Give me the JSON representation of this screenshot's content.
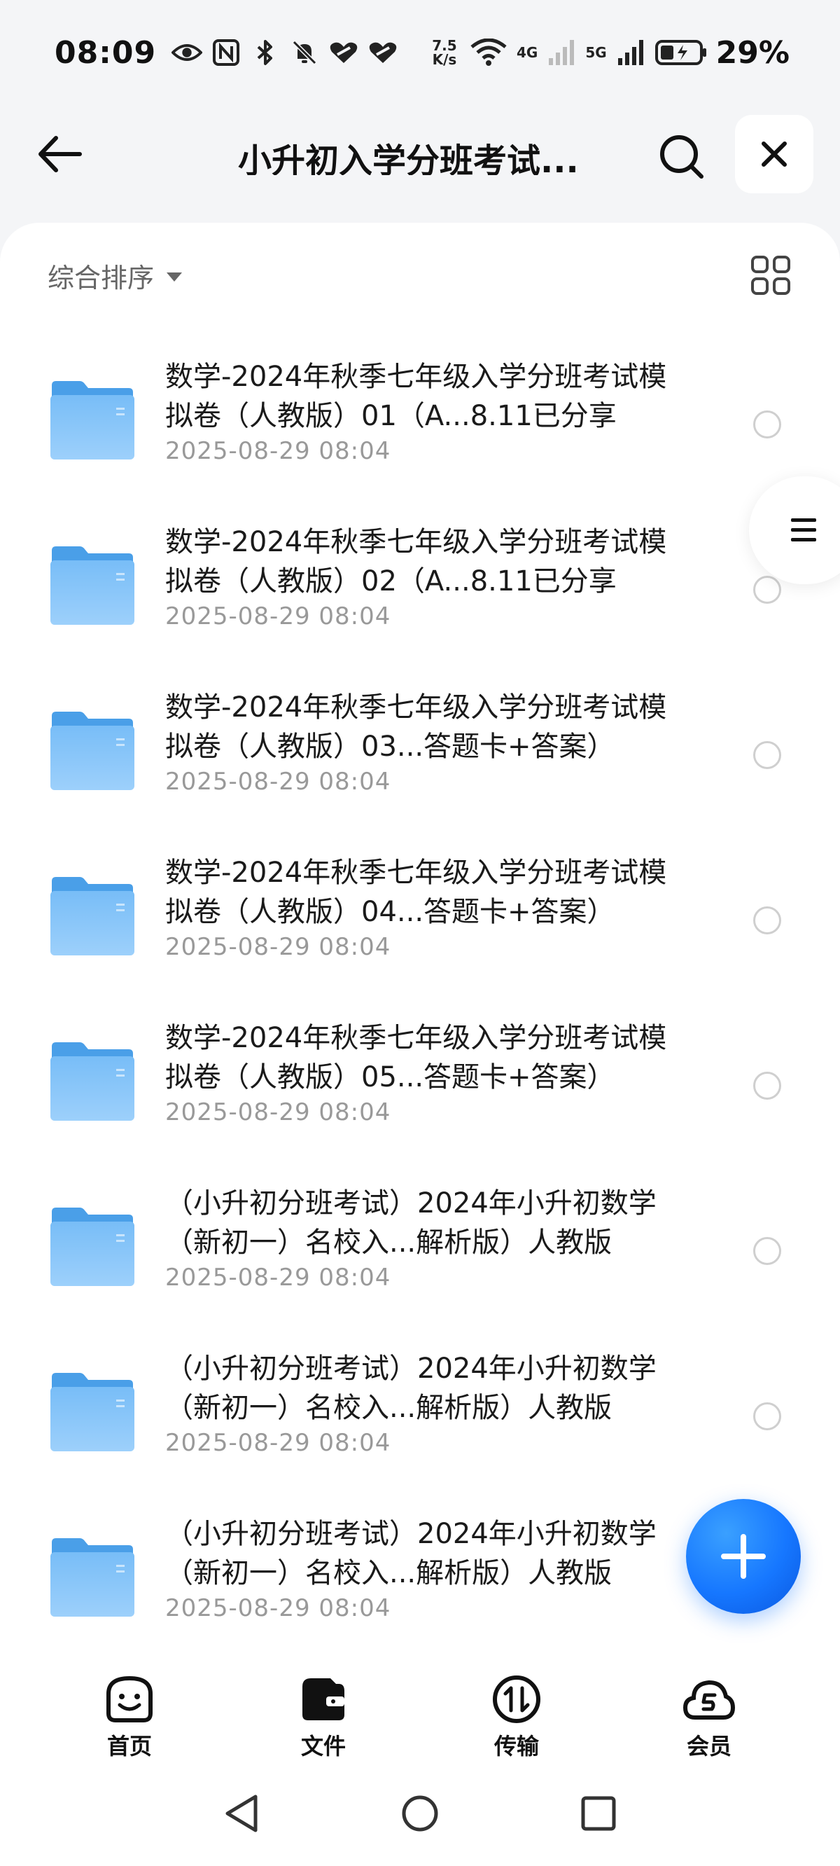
{
  "status_bar": {
    "time": "08:09",
    "net_speed_value": "7.5",
    "net_speed_unit": "K/s",
    "sig_4g": "4G",
    "sig_5g": "5G",
    "battery": "29%"
  },
  "header": {
    "title": "小升初入学分班考试..."
  },
  "toolbar": {
    "sort_label": "综合排序"
  },
  "files": [
    {
      "name": "数学-2024年秋季七年级入学分班考试模拟卷（人教版）01（A...8.11已分享",
      "date": "2025-08-29 08:04"
    },
    {
      "name": "数学-2024年秋季七年级入学分班考试模拟卷（人教版）02（A...8.11已分享",
      "date": "2025-08-29 08:04"
    },
    {
      "name": "数学-2024年秋季七年级入学分班考试模拟卷（人教版）03...答题卡+答案）",
      "date": "2025-08-29 08:04"
    },
    {
      "name": "数学-2024年秋季七年级入学分班考试模拟卷（人教版）04...答题卡+答案）",
      "date": "2025-08-29 08:04"
    },
    {
      "name": "数学-2024年秋季七年级入学分班考试模拟卷（人教版）05...答题卡+答案）",
      "date": "2025-08-29 08:04"
    },
    {
      "name": "（小升初分班考试）2024年小升初数学（新初一）名校入...解析版）人教版",
      "date": "2025-08-29 08:04"
    },
    {
      "name": "（小升初分班考试）2024年小升初数学（新初一）名校入...解析版）人教版",
      "date": "2025-08-29 08:04"
    },
    {
      "name": "（小升初分班考试）2024年小升初数学（新初一）名校入...解析版）人教版",
      "date": "2025-08-29 08:04"
    }
  ],
  "bottom_nav": [
    {
      "label": "首页",
      "icon": "smiley-home-icon"
    },
    {
      "label": "文件",
      "icon": "wallet-files-icon"
    },
    {
      "label": "传输",
      "icon": "transfer-icon"
    },
    {
      "label": "会员",
      "icon": "cloud-vip-icon"
    }
  ],
  "colors": {
    "accent": "#1677ff",
    "folder": "#5aacf2",
    "background": "#f4f5f7"
  }
}
